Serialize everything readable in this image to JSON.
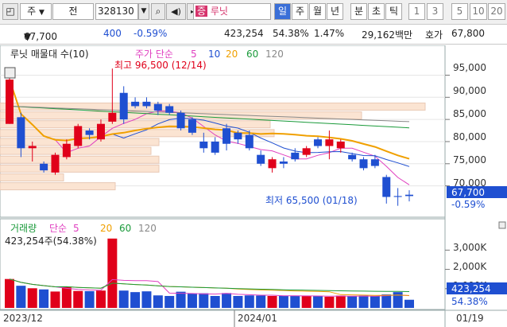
{
  "toolbar": {
    "market": "주",
    "type": "전",
    "code": "328130",
    "group": "증",
    "name": "루닛",
    "periods": [
      "일",
      "주",
      "월",
      "년",
      "분",
      "초",
      "틱"
    ],
    "active_period": "일",
    "intervals": [
      "1",
      "3",
      "5",
      "10",
      "20"
    ]
  },
  "price_row": {
    "price": "67,700",
    "change": "400",
    "change_pct": "-0.59%",
    "volume": "423,254",
    "vol_ratio": "54.38%",
    "turnover": "1.47%",
    "amount": "29,162백만",
    "quote_label": "호가",
    "quote": "67,800"
  },
  "price_panel": {
    "legend_title": "루닛 매물대 수(10)",
    "ma_label": "주가 단순",
    "ma_periods": [
      "5",
      "10",
      "20",
      "60",
      "120"
    ],
    "high_note": "최고 96,500 (12/14)",
    "low_note": "최저 65,500 (01/18)",
    "axis_ticks": [
      "95,000",
      "90,000",
      "85,000",
      "80,000",
      "75,000",
      "70,000"
    ],
    "last_price_tag": "67,700",
    "last_change_tag": "-0.59%"
  },
  "volume_panel": {
    "label": "거래량",
    "ma_label": "단순",
    "ma_periods": [
      "5",
      "20",
      "60",
      "120"
    ],
    "vol_note": "423,254주(54.38%)",
    "axis_ticks": [
      "3,000K",
      "2,000K",
      "1,000K"
    ],
    "last_volume_tag": "423,254",
    "last_ratio_tag": "54.38%"
  },
  "date_axis": [
    "2023/12",
    "2024/01",
    "01/19"
  ],
  "colors": {
    "up": "#e0001a",
    "down": "#1f4fd1",
    "ma5": "#e040c0",
    "ma10": "#1f4fd1",
    "ma20": "#f0a000",
    "ma60": "#1a9a3a",
    "ma120": "#888888"
  },
  "chart_data": {
    "type": "candlestick",
    "x_range": [
      "2023/12",
      "01/19"
    ],
    "y_range": [
      64000,
      98500
    ],
    "candles": [
      {
        "o": 84000,
        "h": 95500,
        "l": 84000,
        "c": 94000,
        "dir": "up"
      },
      {
        "o": 85500,
        "h": 86500,
        "l": 76500,
        "c": 78500,
        "dir": "down"
      },
      {
        "o": 78500,
        "h": 80000,
        "l": 75500,
        "c": 79000,
        "dir": "up"
      },
      {
        "o": 75000,
        "h": 75500,
        "l": 73000,
        "c": 73500,
        "dir": "down"
      },
      {
        "o": 73000,
        "h": 77500,
        "l": 72500,
        "c": 77000,
        "dir": "up"
      },
      {
        "o": 76500,
        "h": 80500,
        "l": 76000,
        "c": 79500,
        "dir": "up"
      },
      {
        "o": 79000,
        "h": 84000,
        "l": 78500,
        "c": 83500,
        "dir": "up"
      },
      {
        "o": 82500,
        "h": 83000,
        "l": 80500,
        "c": 81500,
        "dir": "down"
      },
      {
        "o": 80500,
        "h": 85000,
        "l": 80000,
        "c": 84000,
        "dir": "up"
      },
      {
        "o": 84500,
        "h": 96500,
        "l": 84000,
        "c": 86500,
        "dir": "up"
      },
      {
        "o": 91000,
        "h": 92500,
        "l": 84000,
        "c": 85000,
        "dir": "down"
      },
      {
        "o": 89000,
        "h": 90000,
        "l": 87500,
        "c": 88000,
        "dir": "down"
      },
      {
        "o": 89000,
        "h": 90000,
        "l": 87500,
        "c": 88000,
        "dir": "down"
      },
      {
        "o": 88500,
        "h": 89000,
        "l": 86000,
        "c": 87000,
        "dir": "down"
      },
      {
        "o": 88000,
        "h": 88500,
        "l": 86000,
        "c": 86500,
        "dir": "down"
      },
      {
        "o": 86500,
        "h": 87000,
        "l": 82500,
        "c": 83000,
        "dir": "down"
      },
      {
        "o": 85000,
        "h": 85500,
        "l": 81500,
        "c": 82000,
        "dir": "down"
      },
      {
        "o": 80000,
        "h": 82000,
        "l": 77500,
        "c": 78500,
        "dir": "down"
      },
      {
        "o": 80000,
        "h": 81000,
        "l": 77000,
        "c": 77500,
        "dir": "down"
      },
      {
        "o": 83000,
        "h": 84000,
        "l": 78000,
        "c": 79500,
        "dir": "down"
      },
      {
        "o": 82000,
        "h": 82500,
        "l": 79500,
        "c": 80500,
        "dir": "down"
      },
      {
        "o": 81500,
        "h": 82500,
        "l": 78000,
        "c": 78500,
        "dir": "down"
      },
      {
        "o": 77000,
        "h": 78000,
        "l": 74500,
        "c": 75000,
        "dir": "down"
      },
      {
        "o": 74000,
        "h": 76500,
        "l": 73000,
        "c": 76000,
        "dir": "up"
      },
      {
        "o": 75500,
        "h": 76500,
        "l": 74000,
        "c": 75000,
        "dir": "down"
      },
      {
        "o": 77500,
        "h": 78500,
        "l": 75500,
        "c": 76000,
        "dir": "down"
      },
      {
        "o": 77000,
        "h": 79000,
        "l": 76500,
        "c": 78500,
        "dir": "up"
      },
      {
        "o": 80500,
        "h": 81000,
        "l": 78500,
        "c": 79000,
        "dir": "down"
      },
      {
        "o": 80500,
        "h": 82500,
        "l": 76000,
        "c": 79000,
        "dir": "up"
      },
      {
        "o": 78500,
        "h": 80500,
        "l": 77500,
        "c": 80000,
        "dir": "up"
      },
      {
        "o": 77000,
        "h": 77500,
        "l": 75500,
        "c": 76000,
        "dir": "down"
      },
      {
        "o": 76000,
        "h": 76500,
        "l": 73500,
        "c": 74000,
        "dir": "down"
      },
      {
        "o": 76000,
        "h": 77000,
        "l": 74000,
        "c": 74500,
        "dir": "down"
      },
      {
        "o": 72000,
        "h": 72500,
        "l": 66000,
        "c": 67500,
        "dir": "down"
      },
      {
        "o": 67700,
        "h": 69500,
        "l": 65500,
        "c": 67500,
        "dir": "down"
      },
      {
        "o": 68000,
        "h": 69000,
        "l": 66500,
        "c": 67700,
        "dir": "down"
      }
    ],
    "volume_range_k": [
      0,
      3800
    ],
    "volumes_k": [
      1500,
      1150,
      1020,
      960,
      850,
      1100,
      880,
      870,
      900,
      3600,
      900,
      820,
      860,
      650,
      620,
      840,
      760,
      760,
      620,
      770,
      620,
      650,
      640,
      620,
      620,
      620,
      620,
      610,
      580,
      640,
      600,
      640,
      600,
      700,
      820,
      423
    ]
  }
}
